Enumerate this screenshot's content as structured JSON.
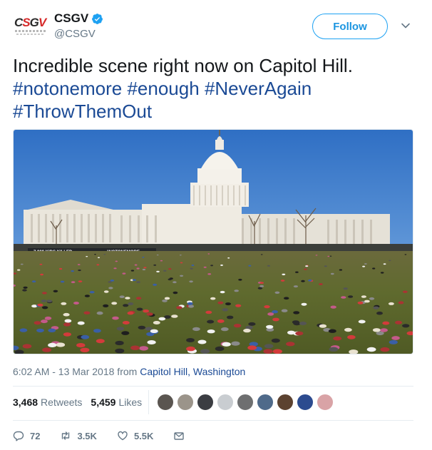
{
  "header": {
    "avatar_logo": "CSGV",
    "display_name": "CSGV",
    "handle": "@CSGV",
    "follow_label": "Follow"
  },
  "tweet": {
    "text_plain": "Incredible scene right now on Capitol Hill.",
    "hashtags_line1": [
      "#notonemore",
      "#enough",
      "#NeverAgain"
    ],
    "hashtags_line2": [
      "#ThrowThemOut"
    ]
  },
  "photo": {
    "banner_left": "7,000 KIDS KILLED",
    "banner_right": "#NOTONEMORE"
  },
  "meta": {
    "time_date": "6:02 AM - 13 Mar 2018 from ",
    "location": "Capitol Hill, Washington"
  },
  "stats": {
    "retweets_count": "3,468",
    "retweets_label": "Retweets",
    "likes_count": "5,459",
    "likes_label": "Likes"
  },
  "actions": {
    "replies": "72",
    "retweets": "3.5K",
    "likes": "5.5K"
  },
  "colors": {
    "accent": "#1da1f2",
    "hashtag": "#1b4a95",
    "muted": "#657786"
  }
}
